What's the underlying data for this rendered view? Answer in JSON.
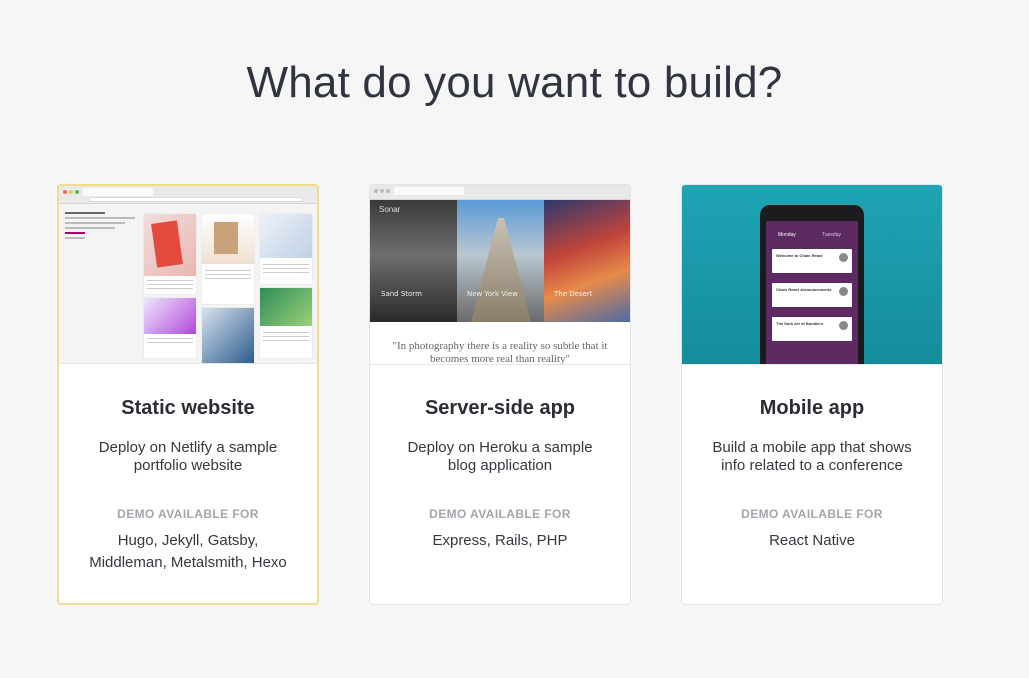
{
  "heading": "What do you want to build?",
  "cards": [
    {
      "title": "Static website",
      "description": "Deploy on Netlify a sample portfolio website",
      "demo_label": "DEMO AVAILABLE FOR",
      "demo_list": "Hugo, Jekyll, Gatsby, Middleman, Metalsmith, Hexo",
      "selected": true
    },
    {
      "title": "Server-side app",
      "description": "Deploy on Heroku a sample blog application",
      "demo_label": "DEMO AVAILABLE FOR",
      "demo_list": "Express, Rails, PHP",
      "thumb": {
        "brand": "Sonar",
        "captions": [
          "Sand Storm",
          "New York View",
          "The Desert"
        ],
        "quote": "\"In photography there is a reality so subtle that it becomes more real than reality\""
      }
    },
    {
      "title": "Mobile app",
      "description": "Build a mobile app that shows info related to a conference",
      "demo_label": "DEMO AVAILABLE FOR",
      "demo_list": "React Native",
      "thumb": {
        "tabs": [
          "Monday",
          "Tuesday"
        ],
        "items": [
          "Welcome to Chain React",
          "Chain React Announcements",
          "The Dark Art of Bundlers"
        ]
      }
    }
  ],
  "colors": {
    "background": "#f6f6f6",
    "selected_border": "#f1dc8c",
    "mobile_bg": "#1ea4b4",
    "app_purple": "#5e2a63"
  }
}
